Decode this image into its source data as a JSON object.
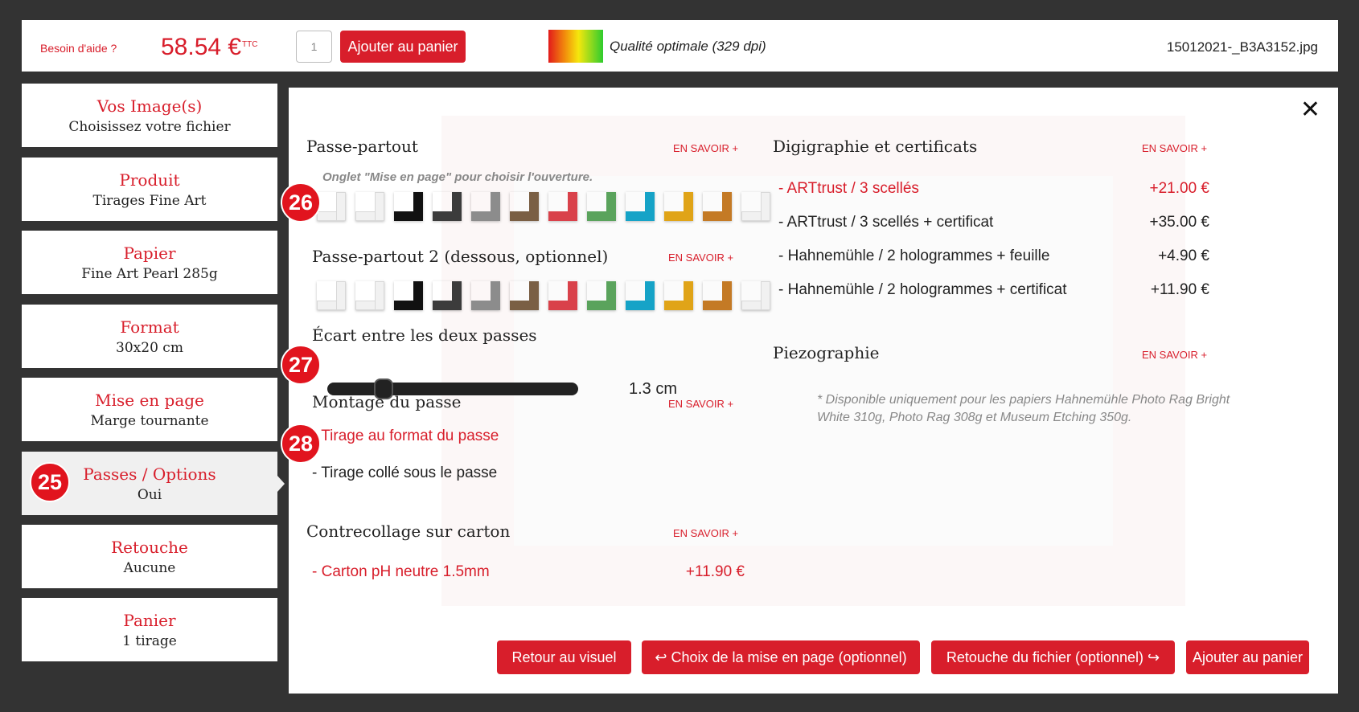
{
  "topbar": {
    "help": "Besoin d'aide ?",
    "price": "58.54 €",
    "ttc": "TTC",
    "quantity": "1",
    "add_to_cart": "Ajouter au panier",
    "quality": "Qualité optimale (329 dpi)",
    "filename": "15012021-_B3A3152.jpg"
  },
  "sidebar": {
    "items": [
      {
        "title": "Vos Image(s)",
        "value": "Choisissez votre fichier"
      },
      {
        "title": "Produit",
        "value": "Tirages Fine Art"
      },
      {
        "title": "Papier",
        "value": "Fine Art Pearl 285g"
      },
      {
        "title": "Format",
        "value": "30x20 cm"
      },
      {
        "title": "Mise en page",
        "value": "Marge tournante"
      },
      {
        "title": "Passes / Options",
        "value": "Oui"
      },
      {
        "title": "Retouche",
        "value": "Aucune"
      },
      {
        "title": "Panier",
        "value": "1 tirage"
      }
    ]
  },
  "badges": {
    "b25": "25",
    "b26": "26",
    "b27": "27",
    "b28": "28"
  },
  "main": {
    "passe_title": "Passe-partout",
    "passe_more": "EN SAVOIR +",
    "passe_note": "Onglet \"Mise en page\" pour choisir l'ouverture.",
    "passe2_title": "Passe-partout 2 (dessous, optionnel)",
    "passe2_more": "EN SAVOIR +",
    "swatch_colors": [
      "#f1f1f1",
      "#f1f1f1",
      "#111111",
      "#3c3c3c",
      "#8c8c8c",
      "#7a5f44",
      "#d9414a",
      "#5aa35c",
      "#16a3c7",
      "#e0a418",
      "#c47a25",
      "#f1f1f1"
    ],
    "gap_title": "Écart entre les deux passes",
    "gap_value": "1.3 cm",
    "gap_fraction": 0.2,
    "mount_title": "Montage du passe",
    "mount_more": "EN SAVOIR +",
    "mount_opt1": "- Tirage au format du passe",
    "mount_opt2": "- Tirage collé sous le passe",
    "contre_title": "Contrecollage sur carton",
    "contre_more": "EN SAVOIR +",
    "contre_opt": "- Carton pH neutre 1.5mm",
    "contre_price": "+11.90 €",
    "digi_title": "Digigraphie et certificats",
    "digi_more": "EN SAVOIR +",
    "digi_options": [
      {
        "label": "- ARTtrust / 3 scellés",
        "price": "+21.00 €"
      },
      {
        "label": "- ARTtrust / 3 scellés + certificat",
        "price": "+35.00 €"
      },
      {
        "label": "- Hahnemühle / 2 hologrammes + feuille",
        "price": "+4.90 €"
      },
      {
        "label": "- Hahnemühle / 2 hologrammes + certificat",
        "price": "+11.90 €"
      }
    ],
    "piezo_title": "Piezographie",
    "piezo_more": "EN SAVOIR +",
    "piezo_note": "* Disponible uniquement pour les papiers Hahnemühle Photo Rag Bright White 310g, Photo Rag 308g et Museum Etching 350g.",
    "close": "✕"
  },
  "buttons": {
    "back": "Retour au visuel",
    "layout": "↩ Choix de la mise en page (optionnel)",
    "retouch": "Retouche du fichier (optionnel) ↪",
    "add": "Ajouter au panier"
  }
}
